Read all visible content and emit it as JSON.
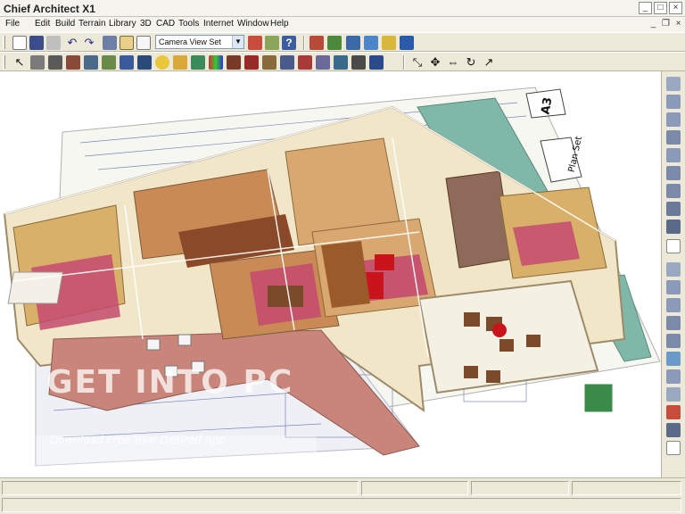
{
  "window": {
    "title": "Chief Architect X1",
    "minimize": "_",
    "maximize": "□",
    "close": "×"
  },
  "menu": {
    "items": [
      "File",
      "Edit",
      "Build",
      "Terrain",
      "Library",
      "3D",
      "CAD",
      "Tools",
      "Internet",
      "Window",
      "Help"
    ],
    "mdi_minimize": "_",
    "mdi_restore": "❐",
    "mdi_close": "×"
  },
  "toolbar1": {
    "camera_view_select": "Camera View Set"
  },
  "plan_sheet": {
    "label": "A3",
    "title": "Plan Set"
  },
  "watermark": {
    "title": "GET INTO PC",
    "subtitle": "Download Free Your Desired App"
  },
  "colors": {
    "chrome_background": "#ece9d8",
    "wall_cream": "#f1e6c8",
    "deck_brick": "#c9857a",
    "floor_wood": "#c98a55",
    "rug_pink": "#c44a6e",
    "sofa_red": "#c8141a",
    "roof_tile_teal": "#7fb8a8",
    "stone_chimney": "#8e6a5a"
  }
}
